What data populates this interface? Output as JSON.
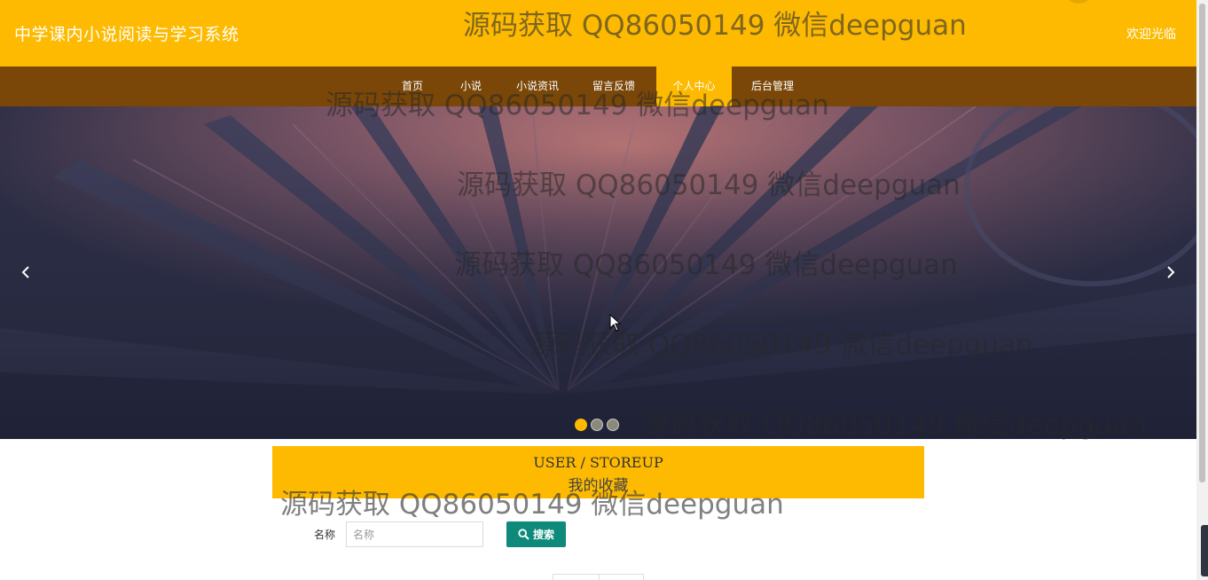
{
  "header": {
    "site_title": "中学课内小说阅读与学习系统",
    "welcome": "欢迎光临"
  },
  "nav": {
    "items": [
      {
        "label": "首页",
        "active": false
      },
      {
        "label": "小说",
        "active": false
      },
      {
        "label": "小说资讯",
        "active": false
      },
      {
        "label": "留言反馈",
        "active": false
      },
      {
        "label": "个人中心",
        "active": true
      },
      {
        "label": "后台管理",
        "active": false
      }
    ]
  },
  "carousel": {
    "prev_icon": "chevron-left-icon",
    "next_icon": "chevron-right-icon",
    "slide_count": 3,
    "active_slide": 1
  },
  "section": {
    "title_en": "USER / STOREUP",
    "title_cn": "我的收藏"
  },
  "search": {
    "label": "名称",
    "placeholder": "名称",
    "value": "",
    "button_label": "搜索",
    "button_icon": "search-icon"
  },
  "watermark": {
    "text": "源码获取 QQ86050149 微信deepguan"
  },
  "colors": {
    "brand_yellow": "#fdba00",
    "nav_brown": "#7a4708",
    "search_button": "#0d8a7a"
  }
}
